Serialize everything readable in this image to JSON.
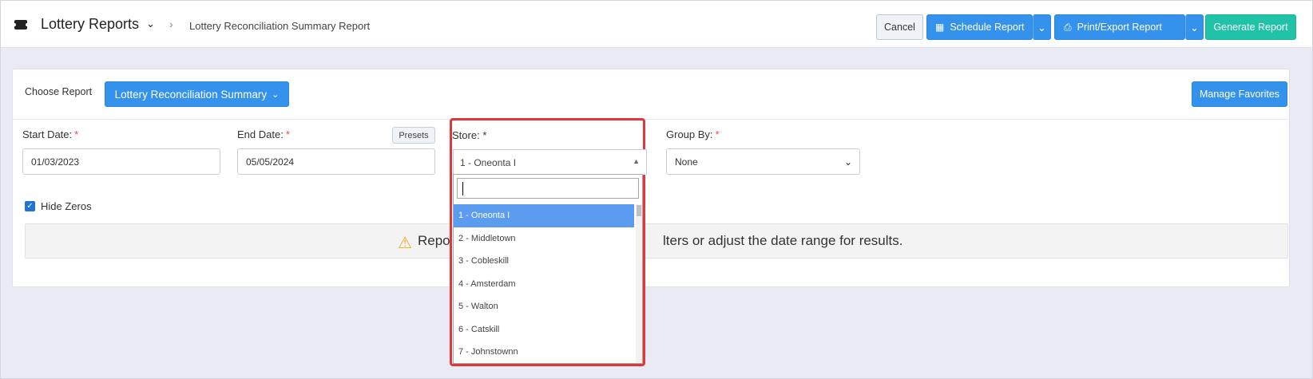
{
  "header": {
    "app_title": "Lottery Reports",
    "breadcrumb_current": "Lottery Reconciliation Summary Report",
    "buttons": {
      "cancel": "Cancel",
      "schedule": "Schedule Report",
      "print_export": "Print/Export Report",
      "generate": "Generate Report"
    }
  },
  "report_chooser": {
    "label": "Choose Report",
    "selected": "Lottery Reconciliation Summary",
    "manage_favorites": "Manage Favorites"
  },
  "filters": {
    "start_date": {
      "label": "Start Date:",
      "value": "01/03/2023"
    },
    "end_date": {
      "label": "End Date:",
      "value": "05/05/2024"
    },
    "presets": "Presets",
    "store": {
      "label": "Store:",
      "selected": "1 - Oneonta I",
      "search_value": "",
      "options": [
        "1 - Oneonta I",
        "2 - Middletown",
        "3 - Cobleskill",
        "4 - Amsterdam",
        "5 - Walton",
        "6 - Catskill",
        "7 - Johnstownn"
      ]
    },
    "group_by": {
      "label": "Group By:",
      "value": "None"
    },
    "hide_zeros": {
      "label": "Hide Zeros",
      "checked": true
    },
    "required_marker": "*"
  },
  "notice": {
    "text_left": "Repo",
    "text_right": "lters or adjust the date range for results."
  },
  "colors": {
    "primary_blue": "#3592ec",
    "teal": "#20c3a8",
    "highlight_red": "#e0373f",
    "option_active": "#5b9cf0"
  }
}
